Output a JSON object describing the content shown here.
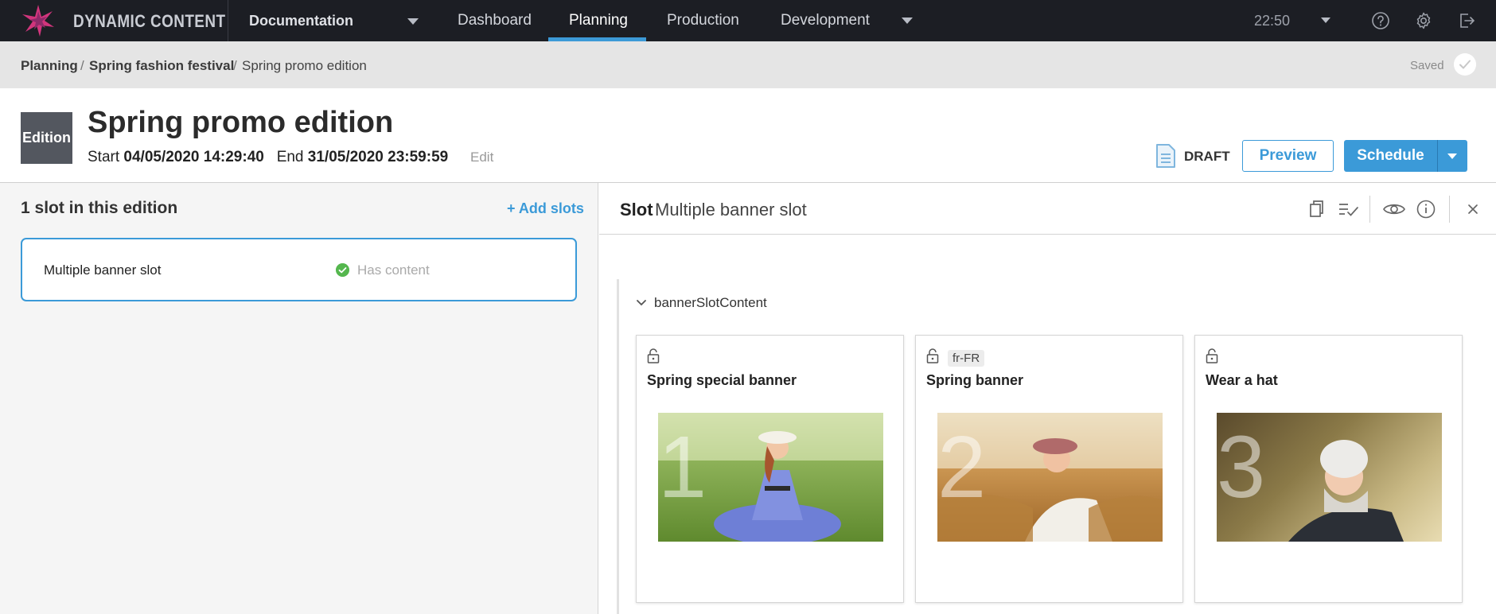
{
  "app": {
    "brand": "DYNAMIC CONTENT",
    "hub": "Documentation",
    "tabs": [
      {
        "label": "Dashboard",
        "active": false
      },
      {
        "label": "Planning",
        "active": true
      },
      {
        "label": "Production",
        "active": false
      },
      {
        "label": "Development",
        "active": false
      }
    ],
    "clock": "22:50",
    "icons": {
      "help": "help-icon",
      "settings": "gear-icon",
      "logout": "logout-icon"
    },
    "accent": "#3b9ad8"
  },
  "breadcrumb": {
    "items": [
      "Planning",
      "Spring fashion festival",
      "Spring promo edition"
    ],
    "separator": "/",
    "status": "Saved"
  },
  "edition": {
    "badge": "Edition",
    "title": "Spring promo edition",
    "start_label": "Start",
    "start": "04/05/2020 14:29:40",
    "end_label": "End",
    "end": "31/05/2020 23:59:59",
    "edit_label": "Edit",
    "state": "DRAFT",
    "preview_label": "Preview",
    "schedule_label": "Schedule"
  },
  "slots_panel": {
    "count_label": "1 slot in this edition",
    "add_label": "+ Add slots",
    "slots": [
      {
        "name": "Multiple banner slot",
        "status": "Has content",
        "status_color": "#55b74e"
      }
    ]
  },
  "slot_detail": {
    "label": "Slot",
    "name": "Multiple banner slot",
    "section": "bannerSlotContent",
    "cards": [
      {
        "title": "Spring special banner",
        "locale": "",
        "index": "1"
      },
      {
        "title": "Spring banner",
        "locale": "fr-FR",
        "index": "2"
      },
      {
        "title": "Wear a hat",
        "locale": "",
        "index": "3"
      }
    ]
  }
}
